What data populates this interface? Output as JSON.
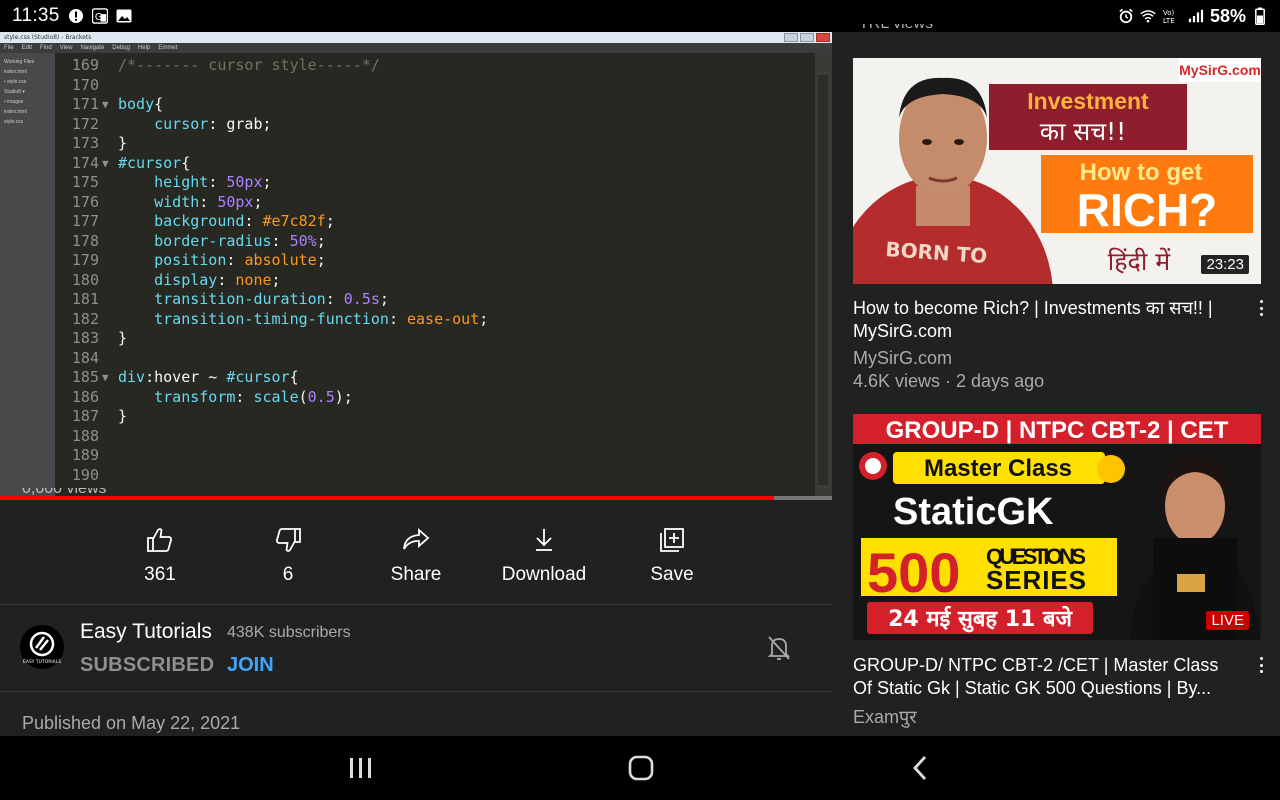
{
  "status_bar": {
    "time": "11:35",
    "battery": "58%",
    "icons": [
      "alert-icon",
      "translate-icon",
      "gallery-icon",
      "alarm-icon",
      "wifi-icon",
      "volte-icon",
      "signal-icon"
    ]
  },
  "ide": {
    "title": "style.css (Studio8) - Brackets",
    "menu": [
      "File",
      "Edit",
      "Find",
      "View",
      "Navigate",
      "Debug",
      "Help",
      "Emmet"
    ],
    "sidebar": [
      "Working Files",
      "index.html",
      "• style.css",
      "Studio8 ▾",
      "• images",
      "index.html",
      "style.css"
    ],
    "lines": [
      {
        "n": "169",
        "fold": "",
        "html": "<span class=\"c-com\">/*------- cursor style-----*/</span>"
      },
      {
        "n": "170",
        "fold": "",
        "html": ""
      },
      {
        "n": "171",
        "fold": "▼",
        "html": "<span class=\"c-sel\">body</span>{"
      },
      {
        "n": "172",
        "fold": "",
        "html": "    <span class=\"c-prop\">cursor</span>: grab;"
      },
      {
        "n": "173",
        "fold": "",
        "html": "}"
      },
      {
        "n": "174",
        "fold": "▼",
        "html": "<span class=\"c-sel\">#cursor</span>{"
      },
      {
        "n": "175",
        "fold": "",
        "html": "    <span class=\"c-prop\">height</span>: <span class=\"c-num\">50px</span>;"
      },
      {
        "n": "176",
        "fold": "",
        "html": "    <span class=\"c-prop\">width</span>: <span class=\"c-num\">50px</span>;"
      },
      {
        "n": "177",
        "fold": "",
        "html": "    <span class=\"c-prop\">background</span>: <span class=\"c-val\">#e7c82f</span>;"
      },
      {
        "n": "178",
        "fold": "",
        "html": "    <span class=\"c-prop\">border-radius</span>: <span class=\"c-num\">50%</span>;"
      },
      {
        "n": "179",
        "fold": "",
        "html": "    <span class=\"c-prop\">position</span>: <span class=\"c-val\">absolute</span>;"
      },
      {
        "n": "180",
        "fold": "",
        "html": "    <span class=\"c-prop\">display</span>: <span class=\"c-val\">none</span>;"
      },
      {
        "n": "181",
        "fold": "",
        "html": "    <span class=\"c-prop\">transition-duration</span>: <span class=\"c-num\">0.5s</span>;"
      },
      {
        "n": "182",
        "fold": "",
        "html": "    <span class=\"c-prop\">transition-timing-function</span>: <span class=\"c-val\">ease-out</span>;"
      },
      {
        "n": "183",
        "fold": "",
        "html": "}"
      },
      {
        "n": "184",
        "fold": "",
        "html": ""
      },
      {
        "n": "185",
        "fold": "▼",
        "html": "<span class=\"c-sel\">div</span>:hover ~ <span class=\"c-sel\">#cursor</span>{"
      },
      {
        "n": "186",
        "fold": "",
        "html": "    <span class=\"c-prop\">transform</span>: <span class=\"c-prop\">scale</span>(<span class=\"c-num\">0.5</span>);"
      },
      {
        "n": "187",
        "fold": "",
        "html": "}"
      },
      {
        "n": "188",
        "fold": "",
        "html": ""
      },
      {
        "n": "189",
        "fold": "",
        "html": ""
      },
      {
        "n": "190",
        "fold": "",
        "html": ""
      }
    ]
  },
  "player": {
    "progress": 0.93,
    "accent": "#ff0000"
  },
  "actions": [
    {
      "label": "361",
      "icon": "like-icon"
    },
    {
      "label": "6",
      "icon": "dislike-icon"
    },
    {
      "label": "Share",
      "icon": "share-icon"
    },
    {
      "label": "Download",
      "icon": "download-icon"
    },
    {
      "label": "Save",
      "icon": "save-icon"
    }
  ],
  "channel": {
    "name": "Easy Tutorials",
    "subscribers": "438K subscribers",
    "subscribed_label": "SUBSCRIBED",
    "join_label": "JOIN",
    "avatar_text": "EASY TUTORIALS"
  },
  "published": "Published on May 22, 2021",
  "recommendations": [
    {
      "title": "How to become Rich? | Investments का सच!! | MySirG.com",
      "channel": "MySirG.com",
      "meta": "4.6K views · 2 days ago",
      "duration": "23:23",
      "thumb": {
        "brand": "MySirG.com",
        "line1": "Investment",
        "line2": "का सच!!",
        "line3": "How to get",
        "line4": "RICH?",
        "line5": "हिंदी में",
        "shirt": "BORN TO"
      }
    },
    {
      "title": "GROUP-D/ NTPC CBT-2 /CET | Master Class Of Static Gk | Static GK 500 Questions | By...",
      "channel": "Examपुर",
      "badge": "LIVE",
      "thumb": {
        "banner": "GROUP-D | NTPC CBT-2 | CET",
        "master": "Master Class",
        "static": "StaticGK",
        "num": "500",
        "qs1": "QUESTIONS",
        "qs2": "SERIES",
        "date": "24 मई सुबह 11 बजे"
      }
    }
  ],
  "colors": {
    "background": "#212121",
    "link_blue": "#3ea6ff",
    "live_red": "#cc0000"
  }
}
